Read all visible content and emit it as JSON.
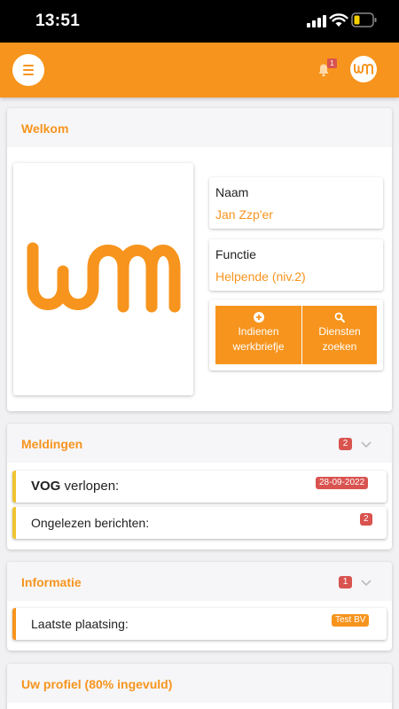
{
  "status_bar": {
    "time": "13:51"
  },
  "header": {
    "notification_count": "1",
    "logo_text": "WAM"
  },
  "welcome": {
    "title": "Welkom",
    "name_label": "Naam",
    "name_value": "Jan Zzp'er",
    "function_label": "Functie",
    "function_value": "Helpende (niv.2)",
    "submit_button": {
      "line1": "Indienen",
      "line2": "werkbriefje"
    },
    "search_button": {
      "line1": "Diensten",
      "line2": "zoeken"
    }
  },
  "meldingen": {
    "title": "Meldingen",
    "count": "2",
    "items": [
      {
        "bold": "VOG",
        "text": " verlopen:",
        "badge": "28-09-2022"
      },
      {
        "bold": "",
        "text": "Ongelezen berichten:",
        "badge": "2"
      }
    ]
  },
  "informatie": {
    "title": "Informatie",
    "count": "1",
    "items": [
      {
        "text": "Laatste plaatsing:",
        "badge": "Test BV"
      }
    ]
  },
  "profiel": {
    "title": "Uw profiel (80% ingevuld)",
    "percent_complete": 80
  },
  "colors": {
    "brand": "#f7941d",
    "badge_red": "#d9534f",
    "alert_yellow": "#f0c430"
  }
}
